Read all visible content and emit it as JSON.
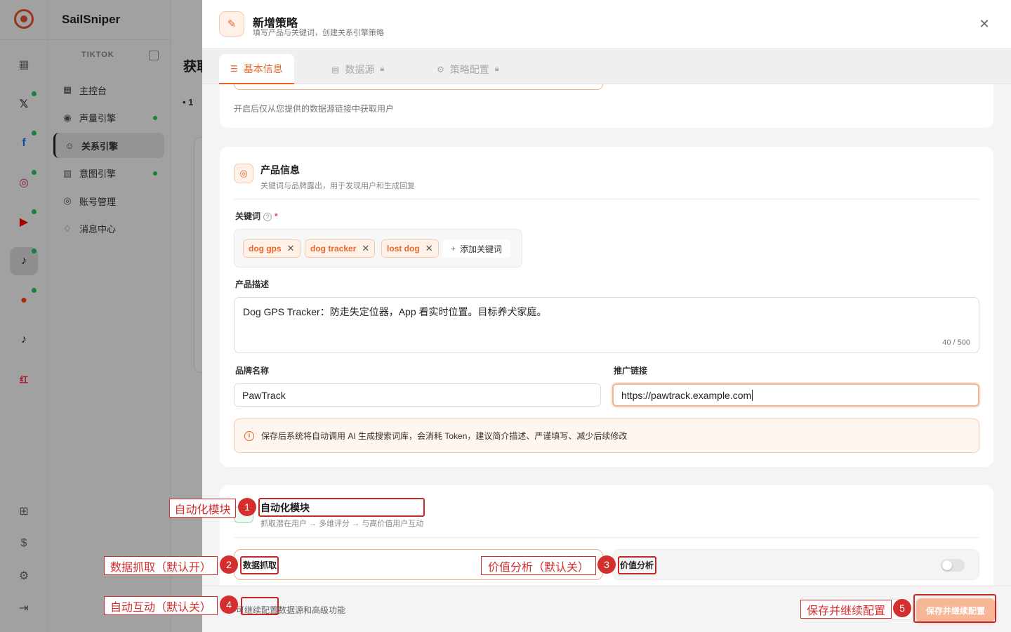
{
  "app": {
    "brand": "SailSniper"
  },
  "rail": {
    "items": [
      {
        "icon": "grid-icon"
      },
      {
        "icon": "x-icon",
        "glyph": "𝕏"
      },
      {
        "icon": "facebook-icon",
        "glyph": "f",
        "color": "#1877f2"
      },
      {
        "icon": "instagram-icon",
        "glyph": "◎",
        "color": "#e1306c"
      },
      {
        "icon": "youtube-icon",
        "glyph": "▶",
        "color": "#ff0000"
      },
      {
        "icon": "tiktok-icon",
        "glyph": "♪"
      },
      {
        "icon": "reddit-icon",
        "glyph": "●",
        "color": "#ff4500"
      },
      {
        "icon": "tiktok-alt-icon",
        "glyph": "♪"
      },
      {
        "icon": "xiaohongshu-icon",
        "glyph": "红",
        "color": "#ff2442"
      }
    ]
  },
  "sidebar": {
    "platform": "TIKTOK",
    "items": [
      {
        "label": "主控台"
      },
      {
        "label": "声量引擎"
      },
      {
        "label": "关系引擎"
      },
      {
        "label": "意图引擎"
      },
      {
        "label": "账号管理"
      },
      {
        "label": "消息中心"
      }
    ]
  },
  "main": {
    "title_fragment": "获取",
    "step_fragment": "• 1"
  },
  "drawer": {
    "title": "新增策略",
    "subtitle": "填写产品与关键词，创建关系引擎策略",
    "tabs": [
      {
        "label": "基本信息"
      },
      {
        "label": "数据源"
      },
      {
        "label": "策略配置"
      }
    ],
    "source_hint": "开启后仅从您提供的数据源链接中获取用户",
    "product": {
      "title": "产品信息",
      "subtitle": "关键词与品牌露出，用于发现用户和生成回复",
      "keywords_label": "关键词",
      "required_mark": "*",
      "keywords": [
        "dog gps",
        "dog tracker",
        "lost dog"
      ],
      "add_keyword": "添加关键词",
      "desc_label": "产品描述",
      "desc_value": "Dog GPS Tracker：防走失定位器，App 看实时位置。目标养犬家庭。",
      "desc_count": "40 / 500",
      "brand_label": "品牌名称",
      "brand_value": "PawTrack",
      "link_label": "推广链接",
      "link_value": "https://pawtrack.example.com",
      "notice": "保存后系统将自动调用 AI 生成搜索词库，会消耗 Token，建议简介描述、严谨填写、减少后续修改"
    },
    "automation": {
      "title": "自动化模块",
      "subtitle": "抓取潜在用户 → 多维评分 → 与高价值用户互动",
      "fetch_label": "数据抓取",
      "value_label": "价值分析"
    },
    "footer": {
      "text": "可继续配置数据源和高级功能",
      "save_button": "保存并继续配置"
    }
  },
  "annotations": [
    {
      "n": "1",
      "label": "自动化模块"
    },
    {
      "n": "2",
      "label": "数据抓取（默认开）"
    },
    {
      "n": "3",
      "label": "价值分析（默认关）"
    },
    {
      "n": "4",
      "label": "自动互动（默认关）"
    },
    {
      "n": "5",
      "label": "保存并继续配置"
    }
  ],
  "colors": {
    "accent": "#e8672b",
    "success": "#22c55e",
    "annotation": "#d32f2f"
  }
}
